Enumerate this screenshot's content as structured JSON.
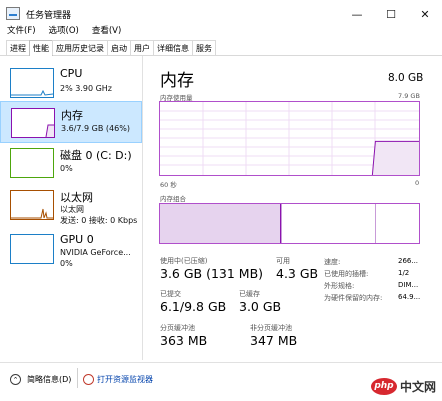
{
  "window": {
    "title": "任务管理器",
    "minimize": "—",
    "maximize": "☐",
    "close": "✕"
  },
  "menu": [
    "文件(F)",
    "选项(O)",
    "查看(V)"
  ],
  "tabs": [
    "进程",
    "性能",
    "应用历史记录",
    "启动",
    "用户",
    "详细信息",
    "服务"
  ],
  "sidebar": {
    "items": [
      {
        "name": "CPU",
        "lines": [
          "2%  3.90 GHz"
        ]
      },
      {
        "name": "内存",
        "lines": [
          "3.6/7.9 GB (46%)"
        ]
      },
      {
        "name": "磁盘 0 (C: D:)",
        "lines": [
          "0%"
        ]
      },
      {
        "name": "以太网",
        "lines": [
          "以太网",
          "发送: 0 接收: 0 Kbps"
        ]
      },
      {
        "name": "GPU 0",
        "lines": [
          "NVIDIA GeForce...",
          "0%"
        ]
      }
    ]
  },
  "memory": {
    "title": "内存",
    "capacity": "8.0 GB",
    "graph_label": "内存使用量",
    "graph_max": "7.9 GB",
    "graph_left": "60 秒",
    "graph_right": "0",
    "composition_label": "内存组合",
    "usage_fraction": 0.46,
    "stats": {
      "in_use_label": "使用中(已压缩)",
      "in_use_value": "3.6 GB (131 MB)",
      "available_label": "可用",
      "available_value": "4.3 GB",
      "committed_label": "已提交",
      "committed_value": "6.1/9.8 GB",
      "cached_label": "已缓存",
      "cached_value": "3.0 GB",
      "paged_label": "分页缓冲池",
      "paged_value": "363 MB",
      "nonpaged_label": "非分页缓冲池",
      "nonpaged_value": "347 MB"
    },
    "details": [
      {
        "label": "速度:",
        "value": "266..."
      },
      {
        "label": "已使用的插槽:",
        "value": "1/2"
      },
      {
        "label": "外形规格:",
        "value": "DIM..."
      },
      {
        "label": "为硬件保留的内存:",
        "value": "64.9..."
      }
    ]
  },
  "footer": {
    "summary": "简略信息(D)",
    "monitor": "打开资源监视器"
  },
  "watermark": {
    "logo": "php",
    "text": "中文网"
  },
  "colors": {
    "accent": "#8b12ae",
    "selection": "#cce8ff"
  }
}
